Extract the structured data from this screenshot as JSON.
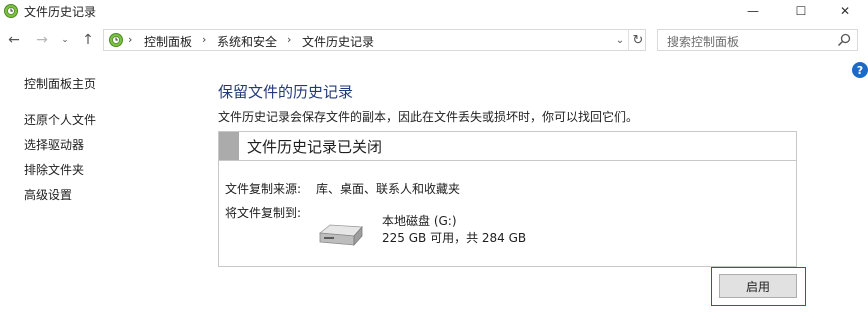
{
  "window": {
    "title": "文件历史记录",
    "controls": {
      "minimize": "—",
      "maximize": "☐",
      "close": "✕"
    }
  },
  "navigation": {
    "breadcrumb": [
      "控制面板",
      "系统和安全",
      "文件历史记录"
    ],
    "search_placeholder": "搜索控制面板"
  },
  "sidebar": {
    "items": [
      {
        "label": "控制面板主页"
      },
      {
        "label": "还原个人文件"
      },
      {
        "label": "选择驱动器"
      },
      {
        "label": "排除文件夹"
      },
      {
        "label": "高级设置"
      }
    ]
  },
  "main": {
    "heading": "保留文件的历史记录",
    "description": "文件历史记录会保存文件的副本，因此在文件丢失或损坏时，你可以找回它们。",
    "status_title": "文件历史记录已关闭",
    "source_label": "文件复制来源:",
    "source_value": "库、桌面、联系人和收藏夹",
    "target_label": "将文件复制到:",
    "drive_name": "本地磁盘 (G:)",
    "drive_space": "225 GB 可用，共 284 GB",
    "enable_button": "启用"
  },
  "colors": {
    "heading": "#223a78",
    "highlight_border": "#c8202a",
    "help_icon": "#1b6bc6"
  }
}
